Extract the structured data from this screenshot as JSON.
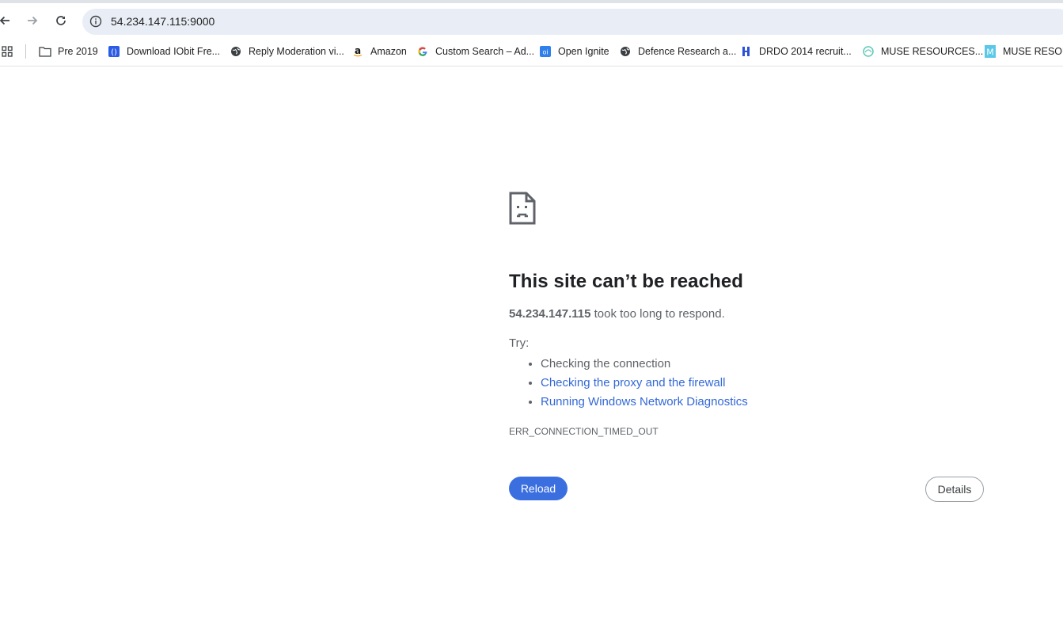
{
  "address_bar": {
    "url": "54.234.147.115:9000"
  },
  "bookmarks": [
    {
      "label": "Pre 2019",
      "icon": "folder-icon"
    },
    {
      "label": "Download IObit Fre...",
      "icon": "iobit-icon"
    },
    {
      "label": "Reply Moderation vi...",
      "icon": "globe-icon"
    },
    {
      "label": "Amazon",
      "icon": "amazon-icon"
    },
    {
      "label": "Custom Search – Ad...",
      "icon": "google-icon"
    },
    {
      "label": "Open Ignite",
      "icon": "oi-icon"
    },
    {
      "label": "Defence Research a...",
      "icon": "globe-icon"
    },
    {
      "label": "DRDO 2014 recruit...",
      "icon": "drdo-icon"
    },
    {
      "label": "MUSE RESOURCES...",
      "icon": "muse-icon"
    },
    {
      "label": "MUSE RESOUR",
      "icon": "m-icon"
    }
  ],
  "error": {
    "title": "This site can’t be reached",
    "host": "54.234.147.115",
    "message": " took too long to respond.",
    "try_label": "Try:",
    "suggestions": [
      "Checking the connection",
      "Checking the proxy and the firewall",
      "Running Windows Network Diagnostics"
    ],
    "code": "ERR_CONNECTION_TIMED_OUT"
  },
  "buttons": {
    "reload": "Reload",
    "details": "Details"
  },
  "colors": {
    "accent": "#3b6fe0",
    "link": "#3369d6",
    "omnibox_bg": "#e9eef6"
  }
}
